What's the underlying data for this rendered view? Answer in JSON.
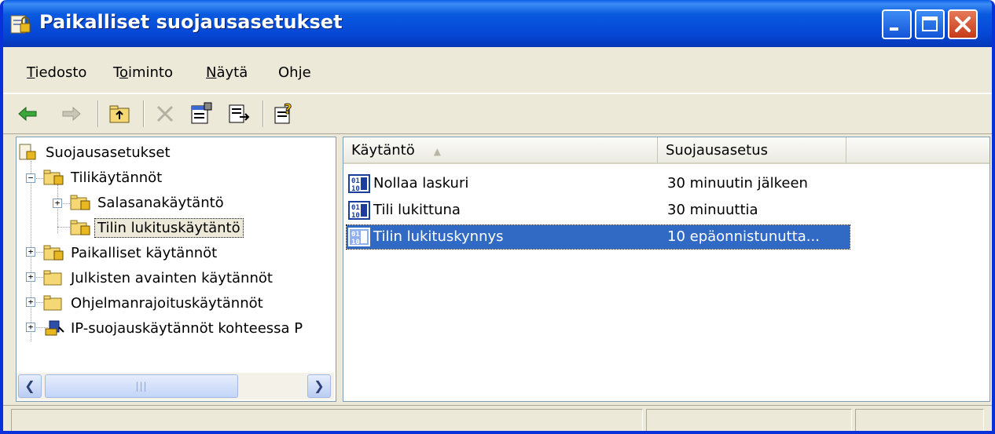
{
  "window": {
    "title": "Paikalliset suojausasetukset",
    "controls": {
      "minimize": "minimize",
      "maximize": "maximize",
      "close": "close"
    }
  },
  "menu": [
    {
      "label": "Tiedosto",
      "accel": "T",
      "rest": "iedosto"
    },
    {
      "label": "Toiminto",
      "accel": "o",
      "pre": "T",
      "rest": "iminto"
    },
    {
      "label": "Näytä",
      "accel": "N",
      "rest": "äytä"
    },
    {
      "label": "Ohje",
      "pre": "Oh",
      "accel": "j",
      "rest": "e"
    }
  ],
  "toolbar": {
    "icons": [
      "back-arrow-icon",
      "forward-arrow-icon",
      "up-folder-icon",
      "delete-icon",
      "properties-icon",
      "export-list-icon",
      "help-icon"
    ]
  },
  "tree": {
    "root": "Suojausasetukset",
    "items": [
      {
        "label": "Tilikäytännöt",
        "expanded": true
      },
      {
        "label": "Salasanakäytäntö",
        "expanded": false
      },
      {
        "label": "Tilin lukituskäytäntö",
        "selected": true
      },
      {
        "label": "Paikalliset käytännöt",
        "expanded": false
      },
      {
        "label": "Julkisten avainten käytännöt",
        "expanded": false
      },
      {
        "label": "Ohjelmanrajoituskäytännöt",
        "expanded": false
      },
      {
        "label": "IP-suojauskäytännöt kohteessa P",
        "expanded": false
      }
    ]
  },
  "list": {
    "columns": [
      "Käytäntö",
      "Suojausasetus",
      ""
    ],
    "rows": [
      {
        "name": "Nollaa laskuri",
        "value": "30 minuutin jälkeen",
        "icon": "numeric-policy-icon"
      },
      {
        "name": "Tili lukittuna",
        "value": "30 minuuttia",
        "icon": "numeric-policy-icon"
      },
      {
        "name": "Tilin lukituskynnys",
        "value": "10 epäonnistunutta...",
        "icon": "numeric-policy-icon",
        "selected": true
      }
    ]
  },
  "colors": {
    "title_bar": "#0548d6",
    "selection": "#316ac5",
    "window_bg": "#ece9d8"
  }
}
